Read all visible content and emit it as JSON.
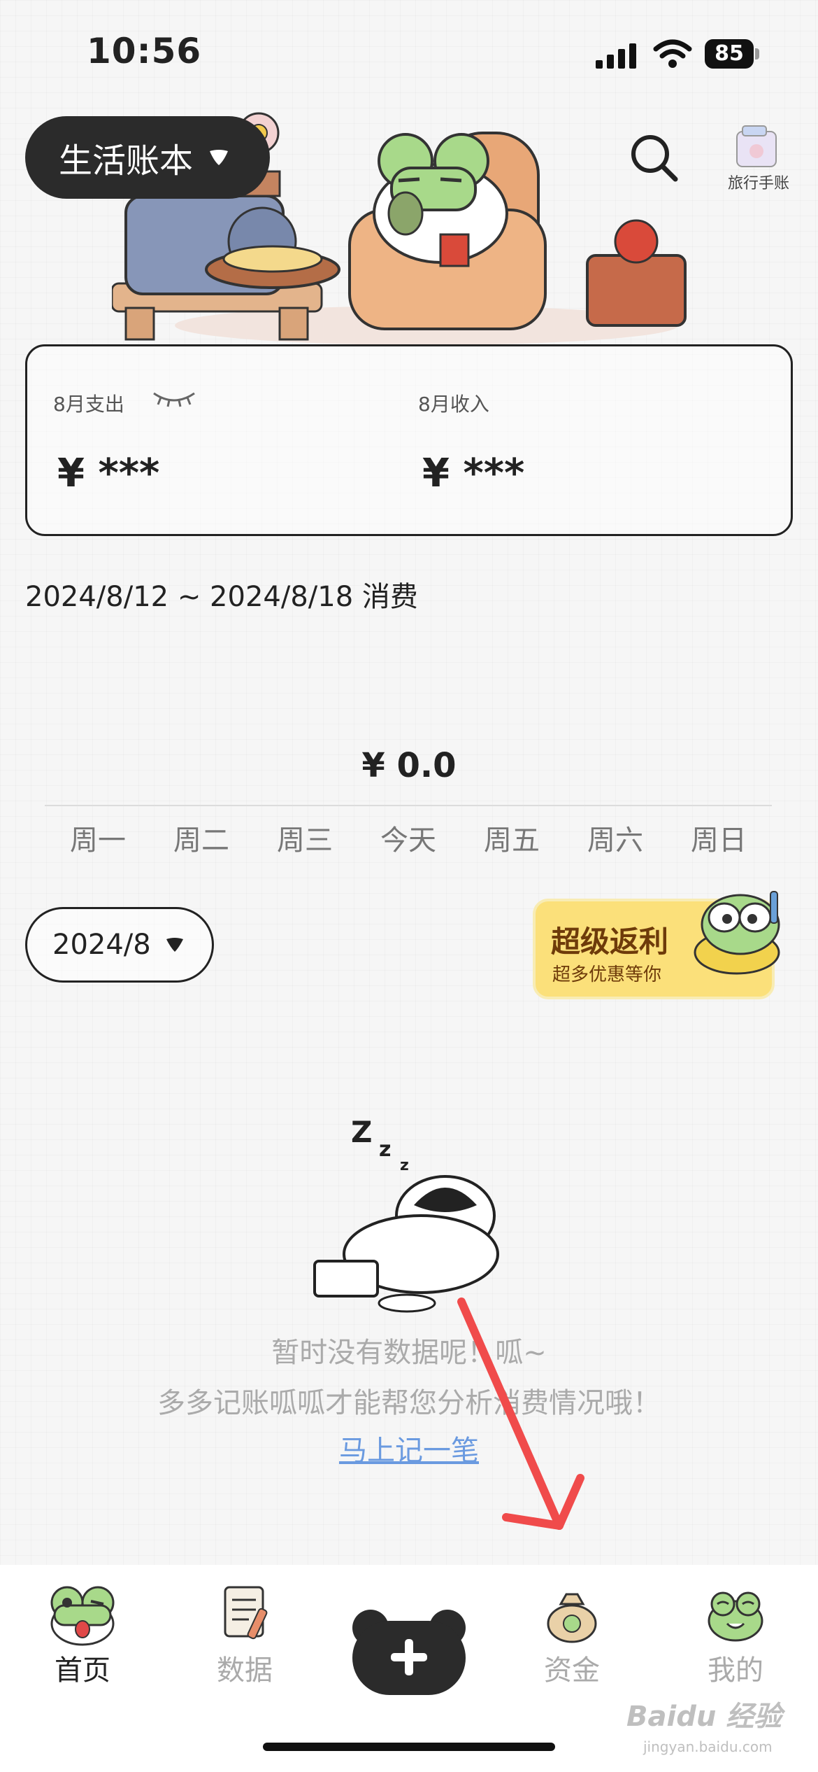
{
  "status_bar": {
    "time": "10:56",
    "battery": "85"
  },
  "header": {
    "book_label": "生活账本",
    "travel_label": "旅行手账"
  },
  "summary": {
    "expense_label": "8月支出",
    "expense_value": "¥ ***",
    "income_label": "8月收入",
    "income_value": "¥ ***"
  },
  "week": {
    "range_text": "2024/8/12 ~ 2024/8/18 消费",
    "total": "¥ 0.0",
    "days": [
      "周一",
      "周二",
      "周三",
      "今天",
      "周五",
      "周六",
      "周日"
    ]
  },
  "month_selector": {
    "label": "2024/8"
  },
  "promo": {
    "title": "超级返利",
    "subtitle": "超多优惠等你"
  },
  "empty_state": {
    "line1": "暂时没有数据呢！呱~",
    "line2": "多多记账呱呱才能帮您分析消费情况哦！",
    "action": "马上记一笔"
  },
  "tabbar": {
    "tabs": [
      {
        "label": "首页",
        "active": true
      },
      {
        "label": "数据",
        "active": false
      },
      {
        "label": "资金",
        "active": false
      },
      {
        "label": "我的",
        "active": false
      }
    ]
  },
  "watermark": {
    "text": "Baidu 经验",
    "sub": "jingyan.baidu.com"
  },
  "colors": {
    "accent_dark": "#2b2b2b",
    "frog_green": "#a8d98a",
    "promo_yellow": "#fbe07a",
    "link_blue": "#6a9ae0"
  }
}
